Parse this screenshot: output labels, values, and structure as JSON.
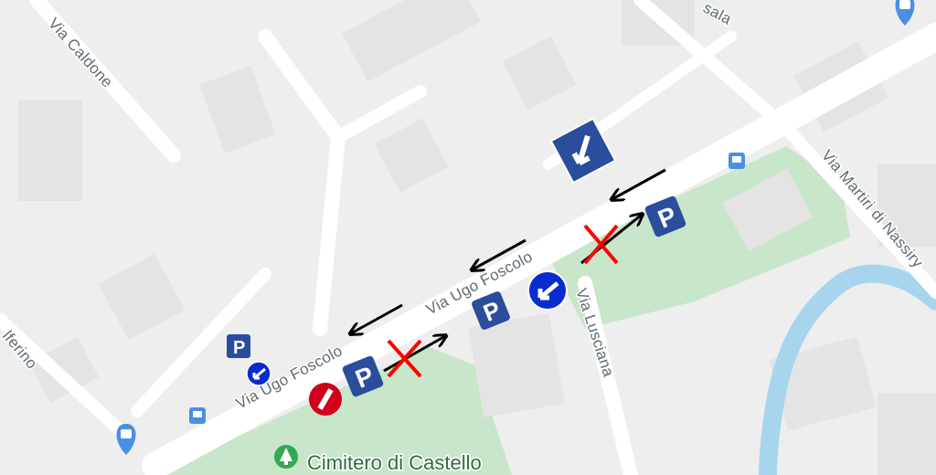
{
  "map": {
    "colors": {
      "background": "#eeeeee",
      "building": "#e4e4e4",
      "road": "#ffffff",
      "park": "#c8e6c9",
      "river": "#a8d5ee",
      "sign_blue": "#2a4d9c",
      "sign_red": "#d0021b",
      "arrow": "#000000",
      "cross": "#ff0000",
      "poi_green": "#34a853"
    },
    "streets": {
      "caldone": "Via Caldone",
      "ugo_foscolo_1": "Via Ugo Foscolo",
      "ugo_foscolo_2": "Via Ugo Foscolo",
      "lusciana": "Via Lusciana",
      "martiri": "Via Martiri di Nassiry",
      "solferino": "lferino",
      "top_cut": "sala"
    },
    "pois": {
      "cemetery": "Cimitero di Castello"
    },
    "signs": {
      "parking_letter": "P"
    },
    "icons": [
      "shopping-bag-pin-icon",
      "bus-stop-icon",
      "parking-sign-icon",
      "keep-left-sign-icon",
      "no-entry-sign-icon",
      "one-way-sign-icon",
      "direction-arrow-icon",
      "no-parking-cross-icon",
      "cemetery-icon"
    ]
  }
}
